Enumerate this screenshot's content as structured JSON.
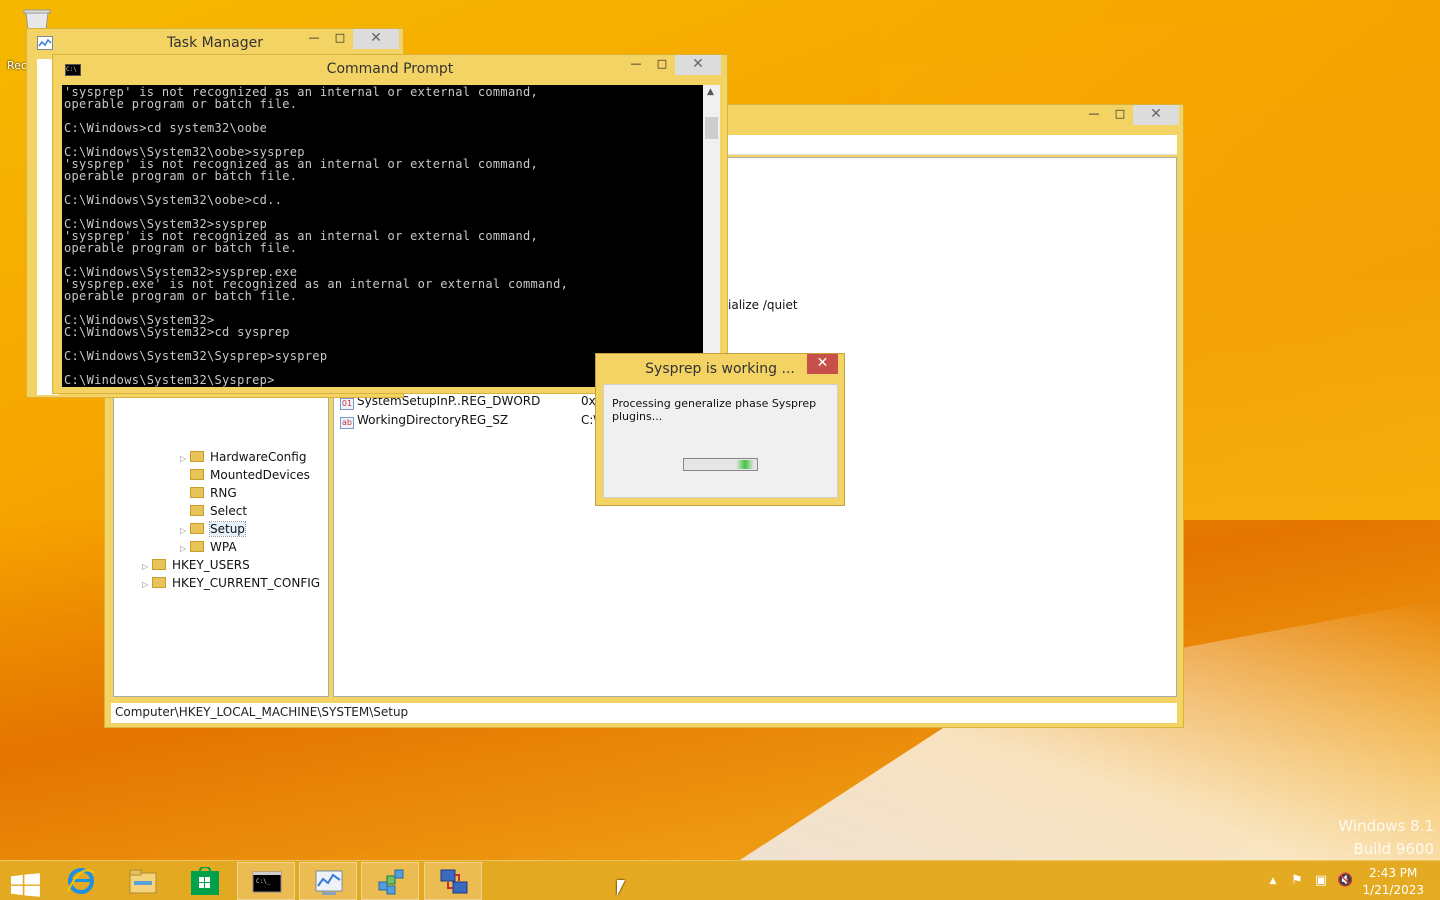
{
  "desktop": {
    "recycle_label": "Rec",
    "watermark": {
      "line1": "Windows 8.1",
      "line2": "Build 9600"
    }
  },
  "task_manager": {
    "title": "Task Manager"
  },
  "command_prompt": {
    "title": "Command Prompt",
    "lines": [
      "'sysprep' is not recognized as an internal or external command,",
      "operable program or batch file.",
      "",
      "C:\\Windows>cd system32\\oobe",
      "",
      "C:\\Windows\\System32\\oobe>sysprep",
      "'sysprep' is not recognized as an internal or external command,",
      "operable program or batch file.",
      "",
      "C:\\Windows\\System32\\oobe>cd..",
      "",
      "C:\\Windows\\System32>sysprep",
      "'sysprep' is not recognized as an internal or external command,",
      "operable program or batch file.",
      "",
      "C:\\Windows\\System32>sysprep.exe",
      "'sysprep.exe' is not recognized as an internal or external command,",
      "operable program or batch file.",
      "",
      "C:\\Windows\\System32>",
      "C:\\Windows\\System32>cd sysprep",
      "",
      "C:\\Windows\\System32\\Sysprep>sysprep",
      "",
      "C:\\Windows\\System32\\Sysprep>"
    ]
  },
  "registry_editor": {
    "partial_text": "ialize /quiet",
    "tree": [
      {
        "label": "HardwareConfig",
        "expandable": true
      },
      {
        "label": "MountedDevices",
        "expandable": false
      },
      {
        "label": "RNG",
        "expandable": false
      },
      {
        "label": "Select",
        "expandable": false
      },
      {
        "label": "Setup",
        "expandable": true
      },
      {
        "label": "WPA",
        "expandable": true
      },
      {
        "label": "HKEY_USERS",
        "expandable": true
      },
      {
        "label": "HKEY_CURRENT_CONFIG",
        "expandable": true
      }
    ],
    "values": [
      {
        "icon": "binary-value-icon",
        "name": "SystemSetupInP...",
        "type": "REG_DWORD",
        "data": "0x0"
      },
      {
        "icon": "string-value-icon",
        "name": "WorkingDirectory",
        "type": "REG_SZ",
        "data": "C:\\"
      }
    ],
    "status_path": "Computer\\HKEY_LOCAL_MACHINE\\SYSTEM\\Setup"
  },
  "sysprep_dialog": {
    "title": "Sysprep is working ...",
    "message": "Processing generalize phase Sysprep plugins...",
    "progress_state": "indeterminate"
  },
  "taskbar": {
    "items": [
      {
        "name": "start-button"
      },
      {
        "name": "internet-explorer-icon"
      },
      {
        "name": "file-explorer-icon"
      },
      {
        "name": "windows-store-icon"
      },
      {
        "name": "command-prompt-icon",
        "active": true
      },
      {
        "name": "task-manager-icon",
        "active": true
      },
      {
        "name": "registry-editor-icon",
        "active": true
      },
      {
        "name": "sysprep-icon",
        "active": true
      }
    ],
    "clock": {
      "time": "2:43 PM",
      "date": "1/21/2023"
    }
  },
  "colors": {
    "window_frame": "#f3d364",
    "close_button": "#c7504a",
    "console_bg": "#000000",
    "console_text": "#c8c8c8"
  }
}
